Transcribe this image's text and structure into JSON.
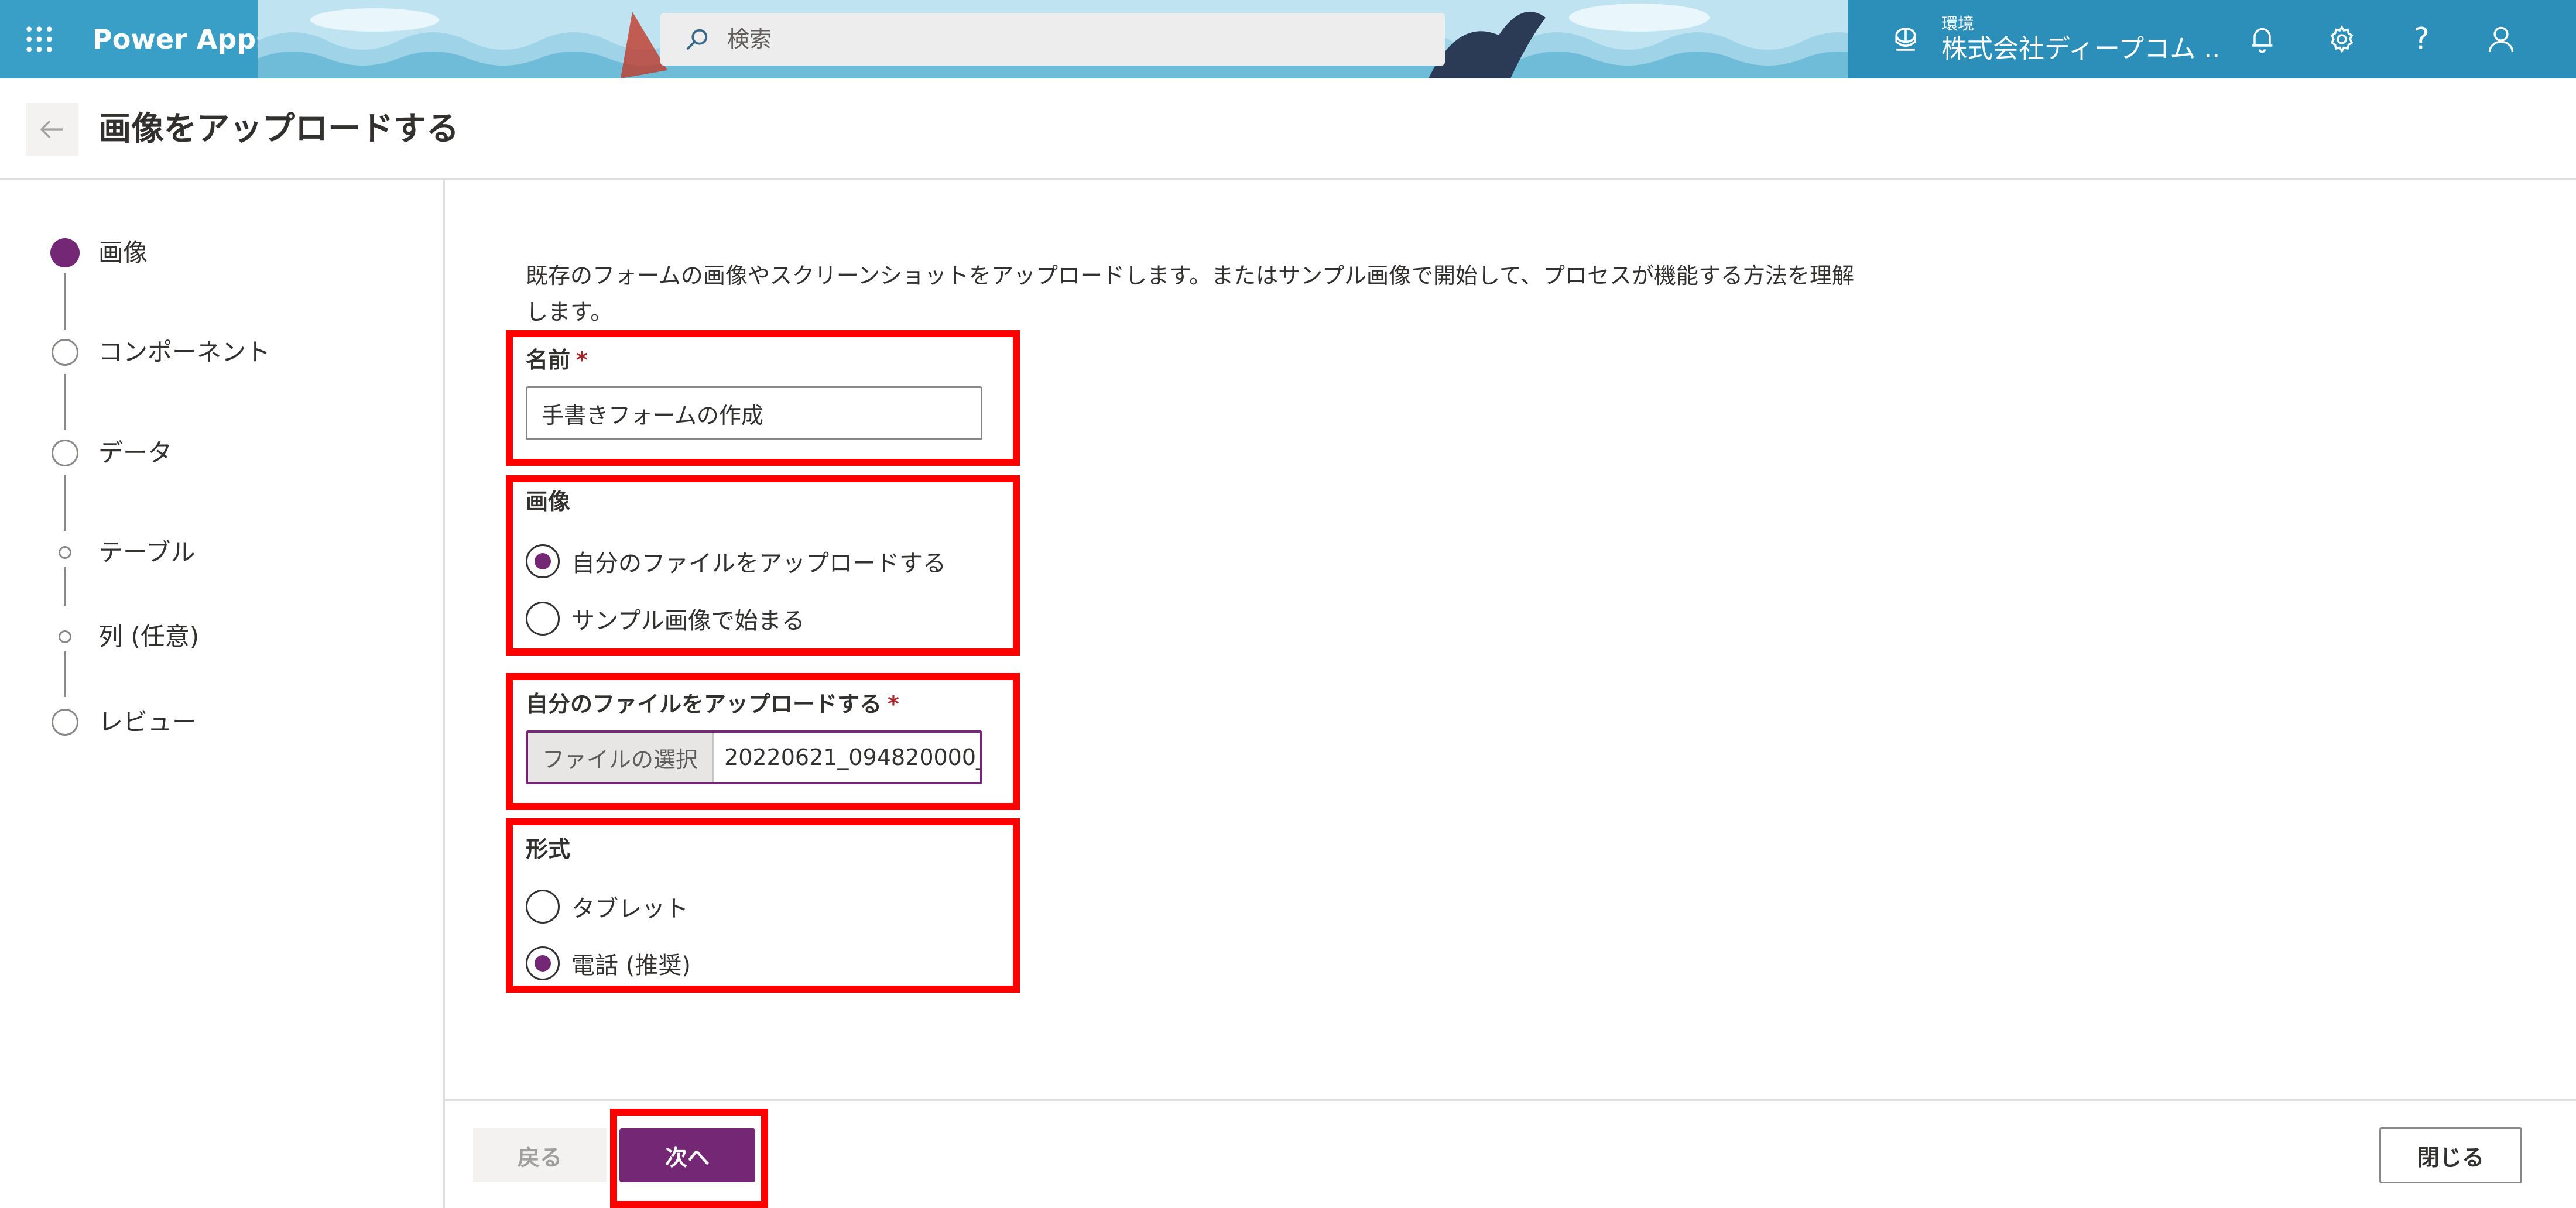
{
  "topbar": {
    "app_name": "Power Apps",
    "search_placeholder": "検索",
    "environment_label": "環境",
    "environment_name": "株式会社ディープコム ...",
    "icons": [
      "waffle-icon",
      "search-icon",
      "environment-icon",
      "bell-icon",
      "gear-icon",
      "help-icon",
      "user-icon"
    ],
    "help_glyph": "?"
  },
  "header": {
    "title": "画像をアップロードする"
  },
  "steps": [
    {
      "label": "画像",
      "state": "current"
    },
    {
      "label": "コンポーネント",
      "state": "pending"
    },
    {
      "label": "データ",
      "state": "pending"
    },
    {
      "label": "テーブル",
      "state": "sub-pending"
    },
    {
      "label": "列 (任意)",
      "state": "sub-pending"
    },
    {
      "label": "レビュー",
      "state": "pending"
    }
  ],
  "main": {
    "description": "既存のフォームの画像やスクリーンショットをアップロードします。またはサンプル画像で開始して、プロセスが機能する方法を理解します。",
    "name_field": {
      "label": "名前",
      "required_mark": "*",
      "value": "手書きフォームの作成"
    },
    "image_field": {
      "label": "画像",
      "options": [
        {
          "label": "自分のファイルをアップロードする",
          "checked": true
        },
        {
          "label": "サンプル画像で始まる",
          "checked": false
        }
      ]
    },
    "upload_field": {
      "label": "自分のファイルをアップロードする",
      "required_mark": "*",
      "choose_label": "ファイルの選択",
      "file_name": "20220621_094820000_"
    },
    "format_field": {
      "label": "形式",
      "options": [
        {
          "label": "タブレット",
          "checked": false
        },
        {
          "label": "電話 (推奨)",
          "checked": true
        }
      ]
    }
  },
  "footer": {
    "back_label": "戻る",
    "next_label": "次へ",
    "close_label": "閉じる"
  },
  "colors": {
    "topbar": "#3a9fc6",
    "accent": "#742774",
    "highlight": "#ff0000"
  }
}
